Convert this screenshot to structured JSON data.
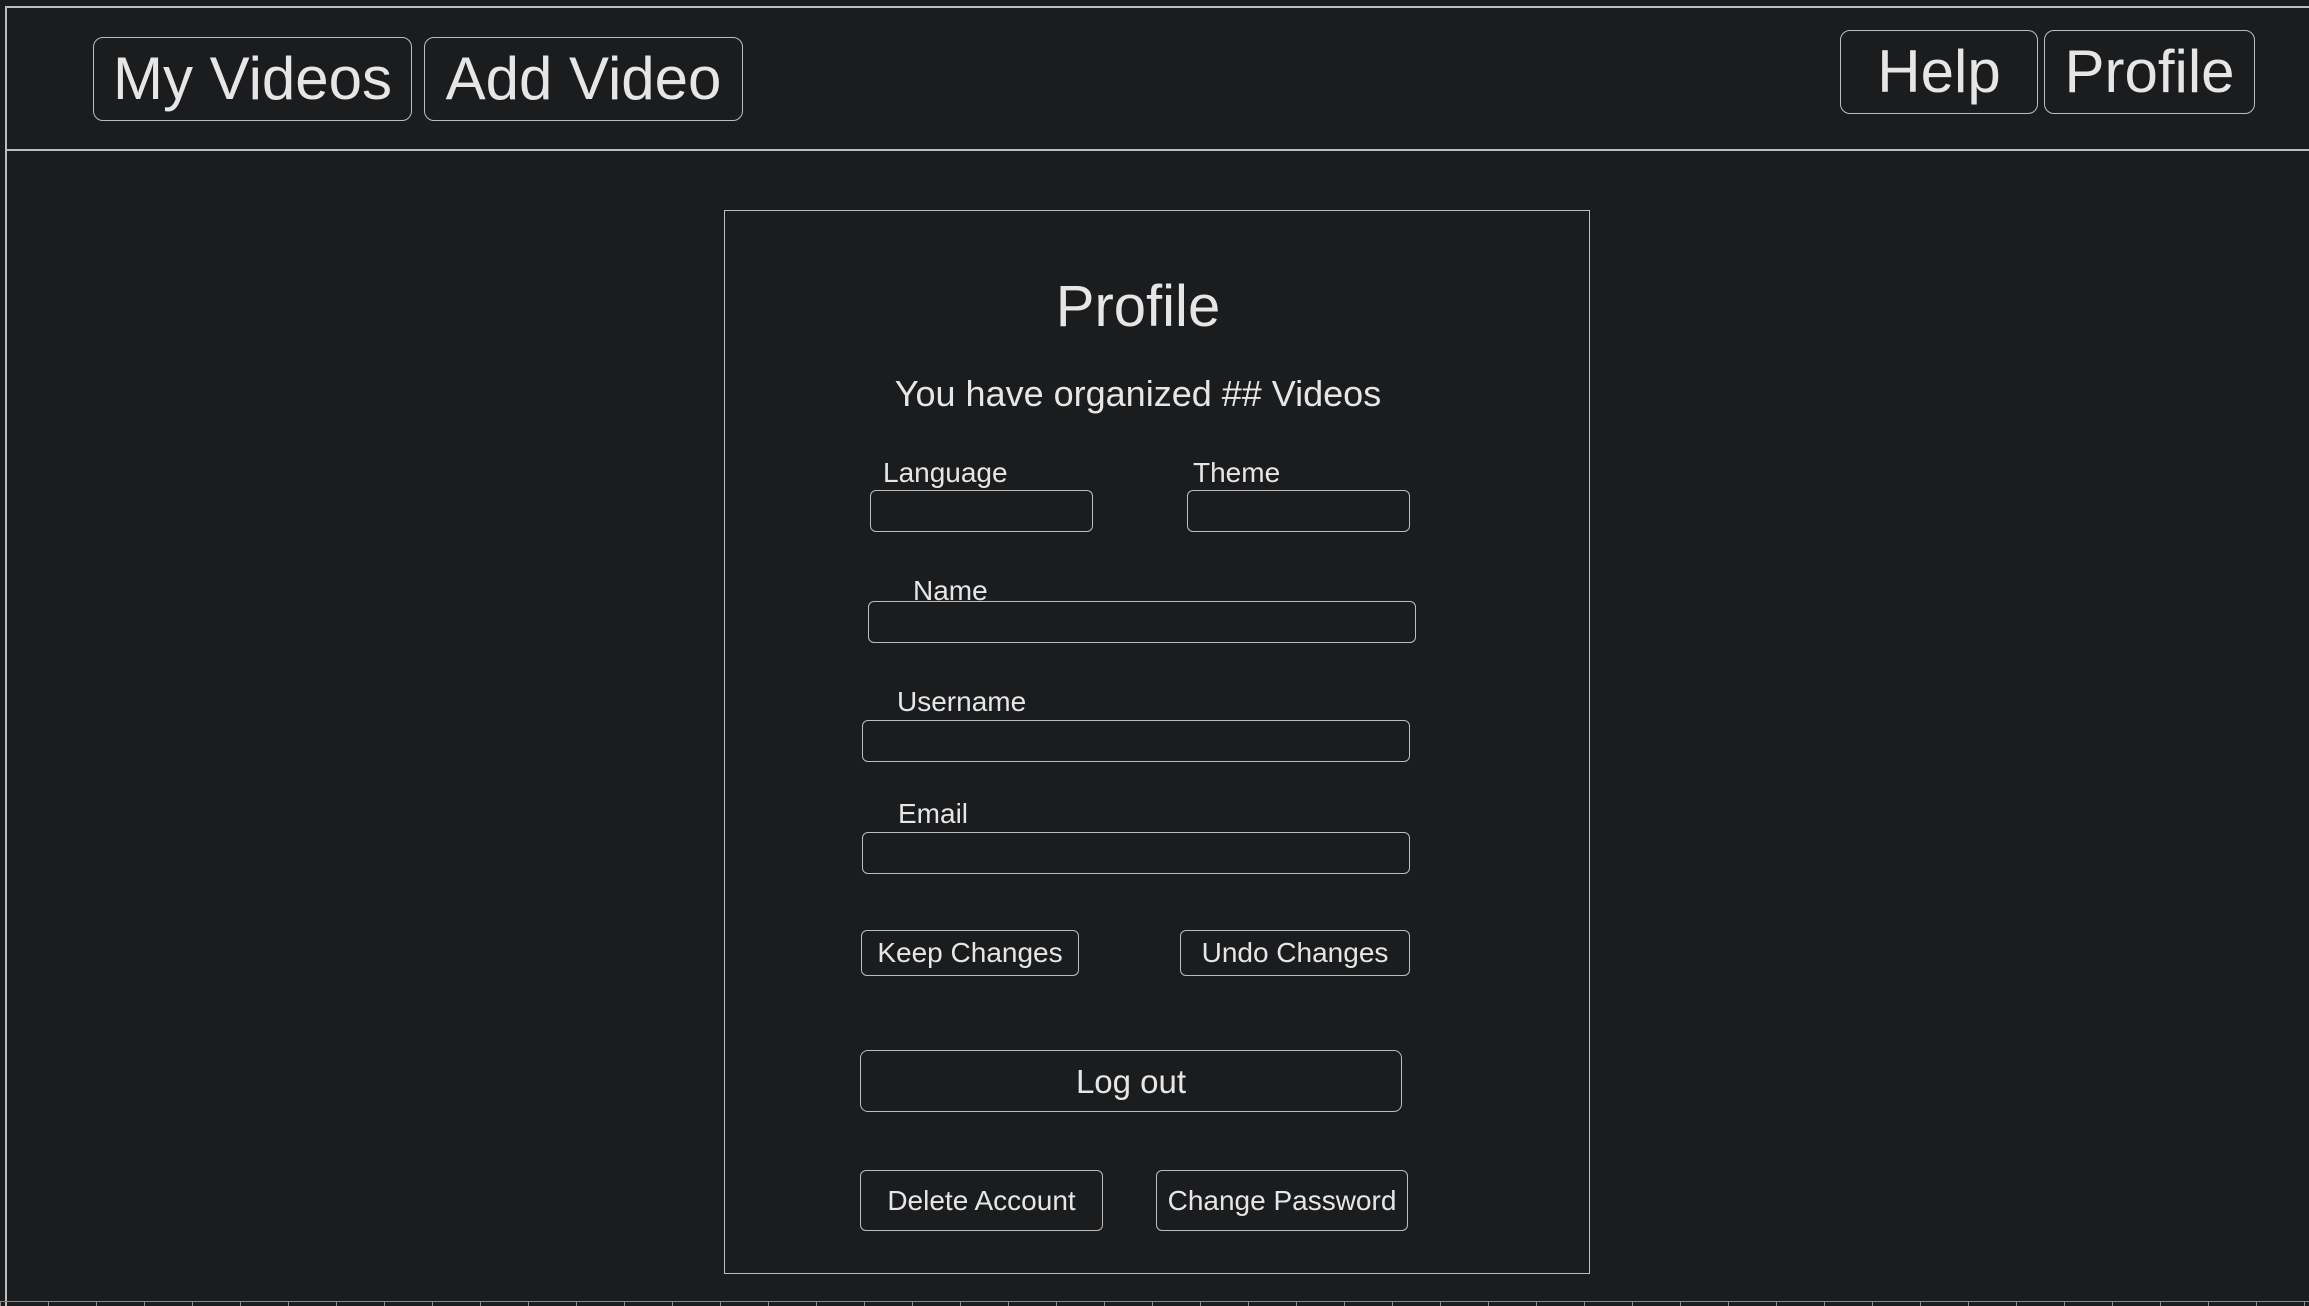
{
  "nav": {
    "my_videos": "My Videos",
    "add_video": "Add Video",
    "help": "Help",
    "profile": "Profile"
  },
  "profile": {
    "title": "Profile",
    "summary": "You have organized ## Videos",
    "fields": {
      "language": {
        "label": "Language",
        "value": ""
      },
      "theme": {
        "label": "Theme",
        "value": ""
      },
      "name": {
        "label": "Name",
        "value": ""
      },
      "username": {
        "label": "Username",
        "value": ""
      },
      "email": {
        "label": "Email",
        "value": ""
      }
    },
    "buttons": {
      "keep_changes": "Keep Changes",
      "undo_changes": "Undo Changes",
      "log_out": "Log out",
      "delete_account": "Delete Account",
      "change_password": "Change Password"
    }
  },
  "colors": {
    "background": "#1b1c1e",
    "text": "#e6e6e6",
    "border": "#bdbdbd"
  }
}
